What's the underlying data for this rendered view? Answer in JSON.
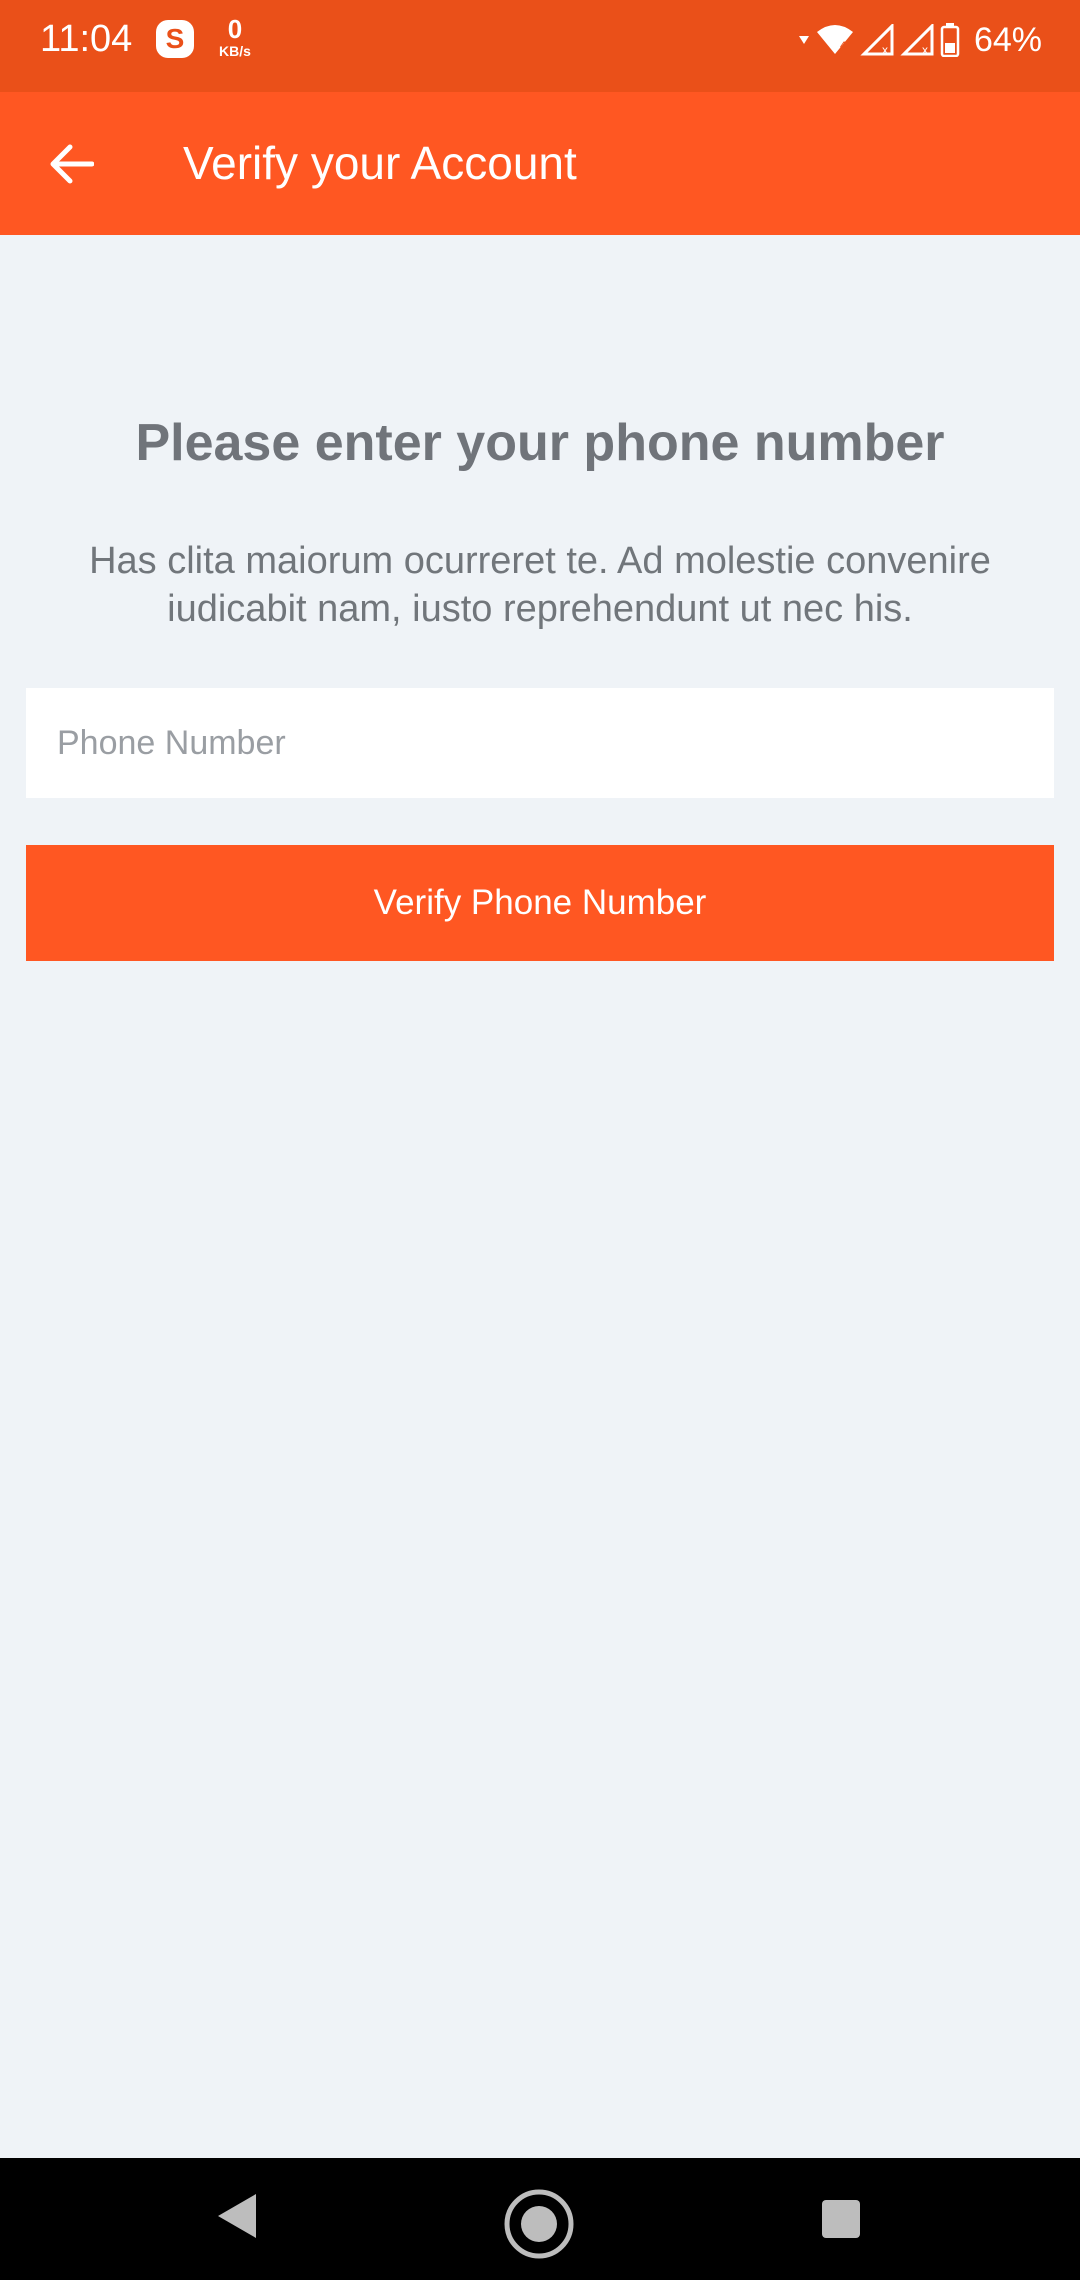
{
  "status_bar": {
    "time": "11:04",
    "app_icon": "skype-icon",
    "net_speed_value": "0",
    "net_speed_unit": "KB/s",
    "battery_percent": "64%",
    "icons": [
      "wifi-icon",
      "signal-icon",
      "signal-icon",
      "battery-icon"
    ]
  },
  "app_bar": {
    "back_icon": "arrow-left-icon",
    "title": "Verify your Account"
  },
  "main": {
    "heading": "Please enter your phone number",
    "description": "Has clita maiorum ocurreret te. Ad molestie convenire iudicabit nam, iusto reprehendunt ut nec his.",
    "phone_input": {
      "value": "",
      "placeholder": "Phone Number"
    },
    "verify_button_label": "Verify Phone Number"
  },
  "nav_bar": {
    "icons": [
      "nav-back-icon",
      "nav-home-icon",
      "nav-recent-icon"
    ]
  },
  "colors": {
    "status_bar": "#ea5019",
    "primary": "#ff5722",
    "background": "#eff3f7",
    "heading_text": "#70747a",
    "body_text": "#71767b"
  }
}
